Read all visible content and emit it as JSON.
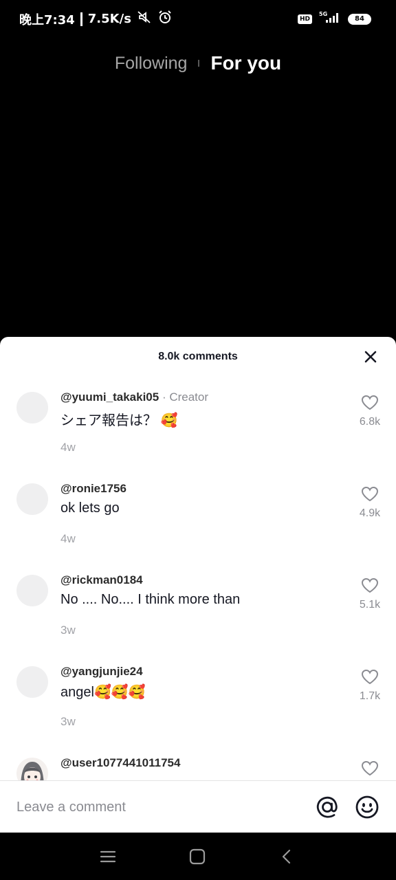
{
  "status_bar": {
    "time": "晚上7:34",
    "net_speed": "7.5K/s",
    "network": "5G",
    "battery": "84"
  },
  "top_tabs": {
    "following": "Following",
    "for_you": "For you"
  },
  "comments_sheet": {
    "title": "8.0k comments",
    "comments": [
      {
        "user": "@yuumi_takaki05",
        "badge": "· Creator",
        "text": "シェア報告は？",
        "emoji": "🥰",
        "time": "4w",
        "likes": "6.8k"
      },
      {
        "user": "@ronie1756",
        "badge": "",
        "text": "ok lets go",
        "emoji": "",
        "time": "4w",
        "likes": "4.9k"
      },
      {
        "user": "@rickman0184",
        "badge": "",
        "text": "No .... No.... I think more than",
        "emoji": "",
        "time": "3w",
        "likes": "5.1k"
      },
      {
        "user": "@yangjunjie24",
        "badge": "",
        "text": "angel",
        "emoji": "🥰🥰🥰",
        "time": "3w",
        "likes": "1.7k"
      },
      {
        "user": "@user1077441011754",
        "badge": "",
        "text": "",
        "emoji": "",
        "time": "",
        "likes": ""
      }
    ]
  },
  "input_bar": {
    "placeholder": "Leave a comment"
  },
  "icons": {
    "close": "close-icon",
    "heart": "heart-icon",
    "mention": "at-icon",
    "emoji": "smiley-icon",
    "menu": "menu-icon",
    "home": "square-icon",
    "back": "back-icon"
  },
  "colors": {
    "background": "#000000",
    "sheet": "#ffffff",
    "secondary_text": "#8a8b91"
  }
}
